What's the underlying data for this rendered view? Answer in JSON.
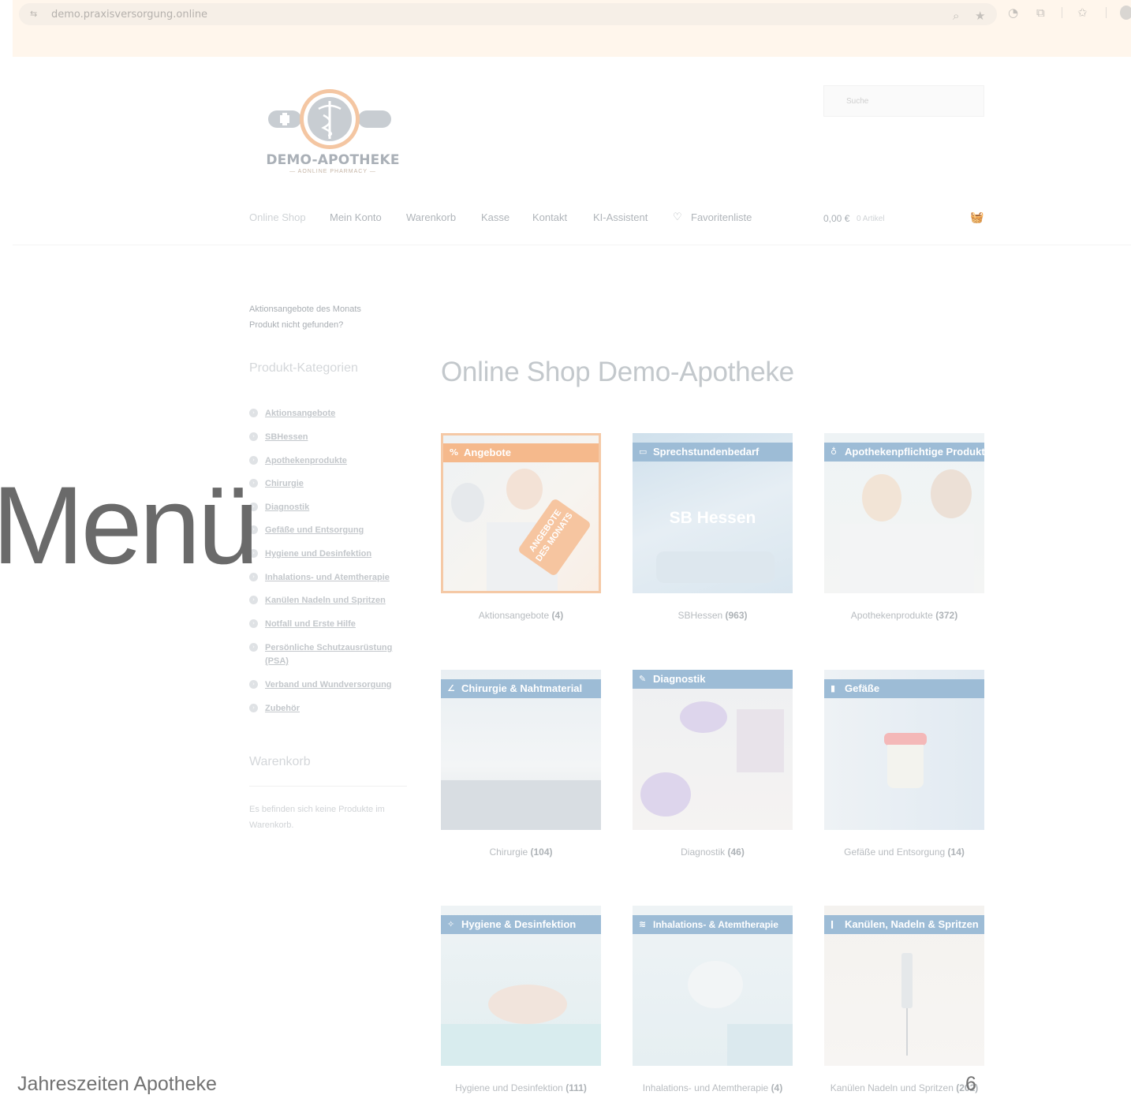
{
  "browser": {
    "url": "demo.praxisversorgung.online",
    "site_icon": "⇆",
    "zoom_icon": "⌕",
    "bookmark_icon": "★",
    "ext1_icon": "◔",
    "ext2_icon": "⧉",
    "ext3_icon": "✩"
  },
  "header": {
    "logo_text": "DEMO-APOTHEKE",
    "logo_sub": "— AONLINE PHARMACY —",
    "search_placeholder": "Suche",
    "nav": [
      "Online Shop",
      "Mein Konto",
      "Warenkorb",
      "Kasse",
      "Kontakt",
      "KI-Assistent",
      "Favoritenliste"
    ],
    "heart_icon": "♡",
    "cart_total": "0,00 €",
    "cart_count": "0 Artikel",
    "basket_icon": "🧺"
  },
  "sidebar": {
    "links": [
      "Aktionsangebote des Monats",
      "Produkt nicht gefunden?"
    ],
    "categories_heading": "Produkt-Kategorien",
    "bullet_icon": "›",
    "categories": [
      "Aktionsangebote",
      "SBHessen",
      "Apothekenprodukte",
      "Chirurgie",
      "Diagnostik",
      "Gefäße und Entsorgung",
      "Hygiene und Desinfektion",
      "Inhalations- und Atemtherapie",
      "Kanülen Nadeln und Spritzen",
      "Notfall und Erste Hilfe",
      "Persönliche Schutzausrüstung (PSA)",
      "Verband und Wundversorgung",
      "Zubehör"
    ],
    "cart_heading": "Warenkorb",
    "cart_empty": "Es befinden sich keine Produkte im Warenkorb."
  },
  "main": {
    "title": "Online Shop Demo-Apotheke",
    "tiles": [
      {
        "banner": "Angebote",
        "icon": "%",
        "center_text": "",
        "name": "Aktionsangebote",
        "count": "(4)"
      },
      {
        "banner": "Sprechstundenbedarf",
        "icon": "▭",
        "center_text": "SB Hessen",
        "name": "SBHessen",
        "count": "(963)"
      },
      {
        "banner": "Apothekenpflichtige Produkte",
        "icon": "♁",
        "center_text": "",
        "name": "Apothekenprodukte",
        "count": "(372)"
      },
      {
        "banner": "Chirurgie & Nahtmaterial",
        "icon": "∠",
        "center_text": "",
        "name": "Chirurgie",
        "count": "(104)"
      },
      {
        "banner": "Diagnostik",
        "icon": "✎",
        "center_text": "",
        "name": "Diagnostik",
        "count": "(46)"
      },
      {
        "banner": "Gefäße",
        "icon": "▮",
        "center_text": "",
        "name": "Gefäße und Entsorgung",
        "count": "(14)"
      },
      {
        "banner": "Hygiene & Desinfektion",
        "icon": "✧",
        "center_text": "",
        "name": "Hygiene und Desinfektion",
        "count": "(111)"
      },
      {
        "banner": "Inhalations- & Atemtherapie",
        "icon": "≋",
        "center_text": "",
        "name": "Inhalations- und Atemtherapie",
        "count": "(4)"
      },
      {
        "banner": "Kanülen, Nadeln & Spritzen",
        "icon": "ǀ",
        "center_text": "",
        "name": "Kanülen Nadeln und Spritzen",
        "count": "(202)"
      }
    ],
    "promo_tag": "ANGEBOTE DES MONATS"
  },
  "overlay": {
    "menu": "Menü",
    "footer_left": "Jahreszeiten Apotheke",
    "page_number": "6"
  },
  "colors": {
    "accent_orange": "#f5b98c",
    "banner_blue": "#9dbcd6",
    "chrome_bg": "#fff6ec"
  }
}
